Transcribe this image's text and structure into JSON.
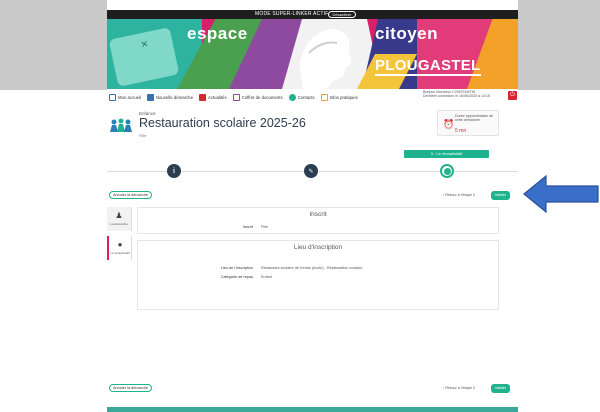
{
  "topbar": {
    "mode_text": "MODE SUPER-LINKER ACTIF",
    "button_label": "Désactiver"
  },
  "banner": {
    "brand_left": "espace",
    "brand_right": "citoyen",
    "town": "PLOUGASTEL",
    "colors": {
      "teal": "#2db3a0",
      "green": "#4aa04e",
      "purple": "#8e4a9e",
      "magenta": "#e23b7a",
      "orange": "#f4a12a",
      "navy": "#3a3a8c"
    }
  },
  "nav": {
    "items": [
      {
        "label": "Mon accueil",
        "icon": "home-icon",
        "color": "#3a6fb0"
      },
      {
        "label": "Nouvelle démarche",
        "icon": "plus-icon",
        "color": "#3a6fb0"
      },
      {
        "label": "Actualités",
        "icon": "news-icon",
        "color": "#d6262f"
      },
      {
        "label": "Coffret de documents",
        "icon": "folder-icon",
        "color": "#8e4a9e"
      },
      {
        "label": "Contacts",
        "icon": "contact-icon",
        "color": "#1fb28e"
      },
      {
        "label": "Infos pratiques",
        "icon": "info-icon",
        "color": "#f4a12a"
      }
    ]
  },
  "user": {
    "line1": "Bonjour Monsieur CONSTANTIN",
    "line2": "Dernière connexion le 16/06/2025 à 14:15"
  },
  "header": {
    "category": "Enfance",
    "title": "Restauration scolaire 2025-26",
    "subtitle": "Fille"
  },
  "help": {
    "text": "Durée approximative de cette démarche",
    "duration": "5 mn"
  },
  "steps": {
    "current_label": "3 - Le récapitulatif"
  },
  "actions": {
    "abandon": "Annuler la démarche",
    "back": "‹ Retour à l'étape 2",
    "submit": "Valider"
  },
  "sidebar": {
    "tabs": [
      {
        "label": "La démarche"
      },
      {
        "label": "Le récapitulatif"
      }
    ]
  },
  "sections": {
    "inscrit": {
      "title": "Inscrit",
      "fields": [
        {
          "label": "Inscrit",
          "value": "Fille"
        }
      ]
    },
    "lieu": {
      "title": "Lieu d'inscription",
      "fields": [
        {
          "label": "Lieu de l'inscription",
          "value": "Restaurant scolaire de Kerlaz (école) - Restauration scolaire"
        },
        {
          "label": "Catégorie de repas",
          "value": "Enfant"
        }
      ]
    }
  }
}
